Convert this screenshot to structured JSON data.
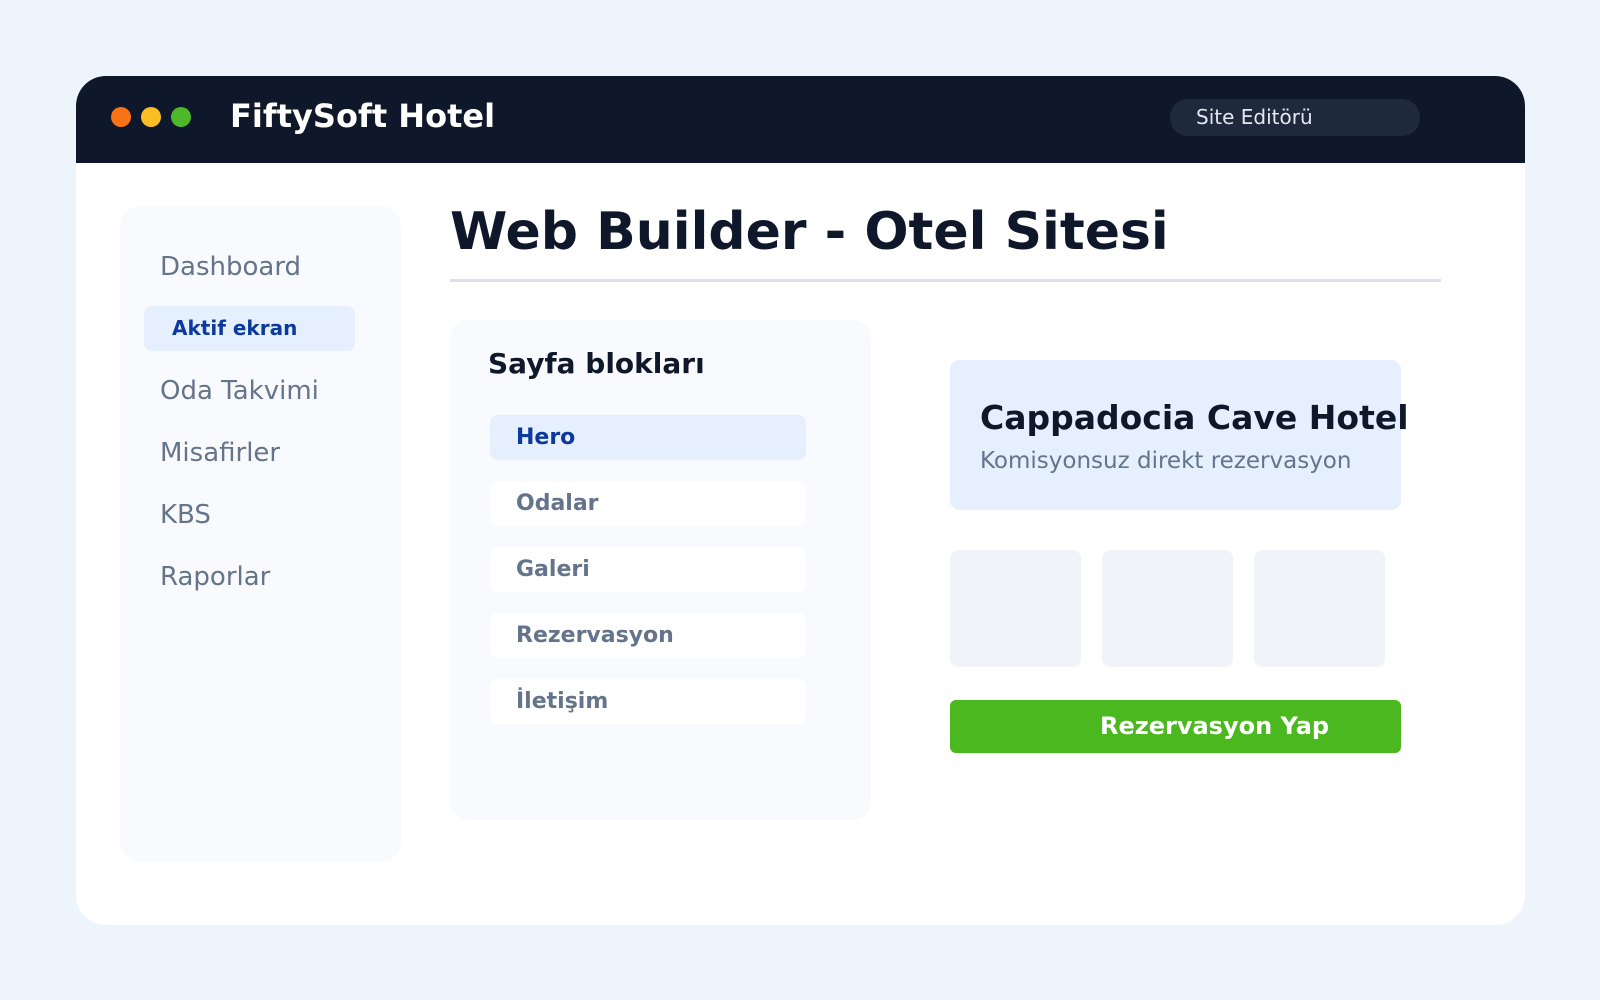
{
  "header": {
    "app_title": "FiftySoft Hotel",
    "mode_label": "Site Editörü"
  },
  "sidebar": {
    "items": [
      {
        "label": "Dashboard"
      },
      {
        "label": "Aktif ekran",
        "active": true
      },
      {
        "label": "Oda Takvimi"
      },
      {
        "label": "Misafirler"
      },
      {
        "label": "KBS"
      },
      {
        "label": "Raporlar"
      }
    ]
  },
  "main": {
    "page_title": "Web Builder - Otel Sitesi",
    "blocks": {
      "heading": "Sayfa blokları",
      "items": [
        {
          "label": "Hero",
          "active": true
        },
        {
          "label": "Odalar"
        },
        {
          "label": "Galeri"
        },
        {
          "label": "Rezervasyon"
        },
        {
          "label": "İletişim"
        }
      ]
    },
    "preview": {
      "hotel_name": "Cappadocia Cave Hotel",
      "tagline": "Komisyonsuz direkt rezervasyon",
      "cta_label": "Rezervasyon Yap"
    }
  },
  "colors": {
    "titlebar": "#0f172a",
    "accent": "#0b3a9c",
    "active_bg": "#e5effd",
    "cta": "#4cb820"
  }
}
